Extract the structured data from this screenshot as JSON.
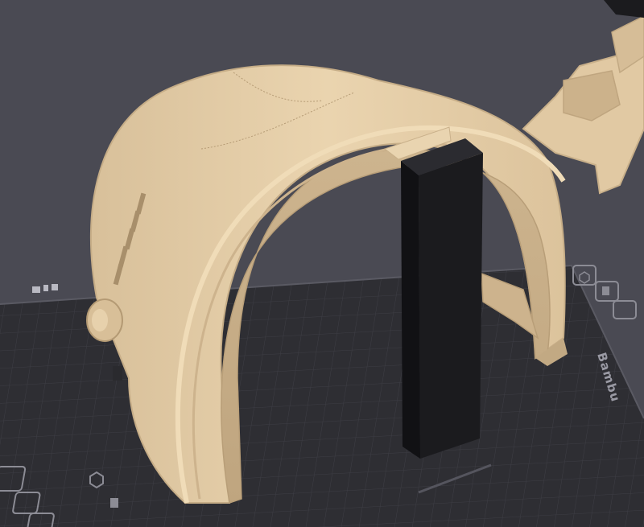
{
  "viewport": {
    "background_color": "#4a4a53",
    "bed_color": "#2e2e33",
    "bed_grid_color": "#3d3d44",
    "model_color": "#e1c9a3",
    "model_shadow_color": "#c9b08a",
    "support_color": "#1b1b1e",
    "accent_color": "#f0b400"
  },
  "bed": {
    "brand_label": "Bambu",
    "icons": [
      "hex-nut-icon",
      "print-head-icon",
      "texture-icon"
    ]
  }
}
